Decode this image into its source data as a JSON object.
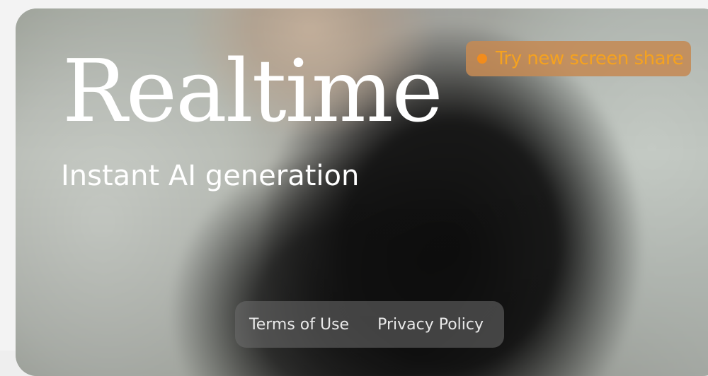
{
  "hero": {
    "title": "Realtime",
    "subtitle": "Instant AI generation"
  },
  "cta": {
    "label": "Try new screen share",
    "dot_color": "#f28c1c",
    "background_color": "#c48a54",
    "icon": "orange-dot-icon"
  },
  "footer": {
    "links": [
      {
        "label": "Terms of Use"
      },
      {
        "label": "Privacy Policy"
      }
    ]
  },
  "colors": {
    "title_text": "#ffffff",
    "cta_text": "#f5a21f"
  }
}
